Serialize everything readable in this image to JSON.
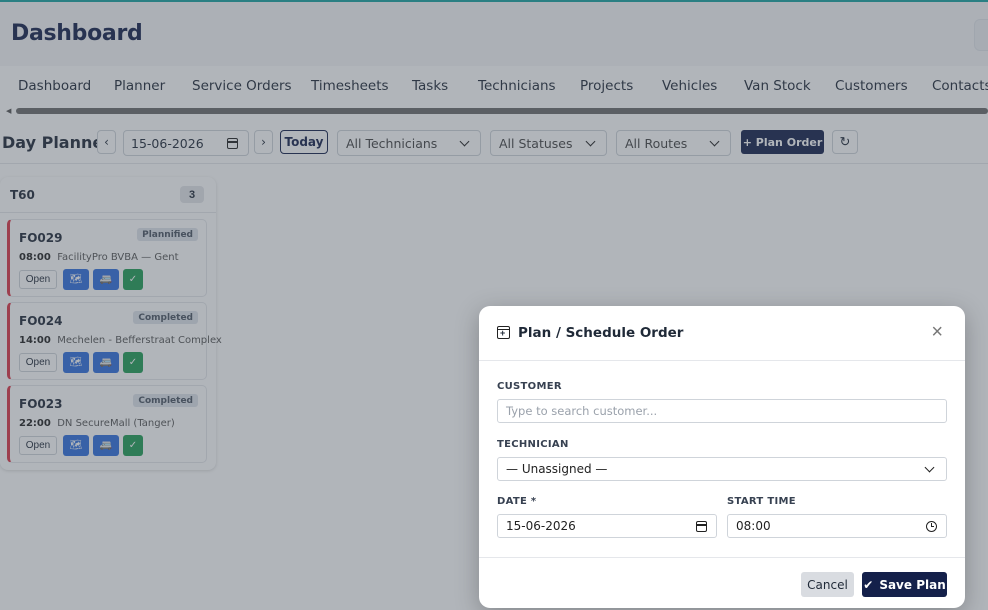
{
  "app": {
    "title": "Dashboard"
  },
  "nav": [
    "Dashboard",
    "Planner",
    "Service Orders",
    "Timesheets",
    "Tasks",
    "Technicians",
    "Projects",
    "Vehicles",
    "Van Stock",
    "Customers",
    "Contacts"
  ],
  "toolbar": {
    "heading": "Day Planner",
    "prev": "‹",
    "next": "›",
    "date": "15-06-2026",
    "today": "Today",
    "technicians": "All Technicians",
    "statuses": "All Statuses",
    "routes": "All Routes",
    "plan_order": "+ Plan Order",
    "refresh": "↻"
  },
  "column": {
    "title": "T60",
    "count": "3",
    "cards": [
      {
        "id": "FO029",
        "status": "Plannified",
        "time": "08:00",
        "location": "FacilityPro BVBA — Gent",
        "open": "Open"
      },
      {
        "id": "FO024",
        "status": "Completed",
        "time": "14:00",
        "location": "Mechelen - Befferstraat Complex",
        "open": "Open"
      },
      {
        "id": "FO023",
        "status": "Completed",
        "time": "22:00",
        "location": "DN SecureMall (Tanger)",
        "open": "Open"
      }
    ]
  },
  "modal": {
    "title": "Plan / Schedule Order",
    "close": "×",
    "customer_label": "CUSTOMER",
    "customer_placeholder": "Type to search customer...",
    "technician_label": "TECHNICIAN",
    "technician_value": "— Unassigned —",
    "date_label": "DATE *",
    "date_value": "15-06-2026",
    "start_label": "START TIME",
    "start_value": "08:00",
    "cancel": "Cancel",
    "save": "Save Plan"
  },
  "colors": {
    "primary": "#14204a",
    "accent": "#17a2a0",
    "danger": "#dc3545",
    "success": "#1f9d55",
    "info": "#2f6fdf"
  }
}
